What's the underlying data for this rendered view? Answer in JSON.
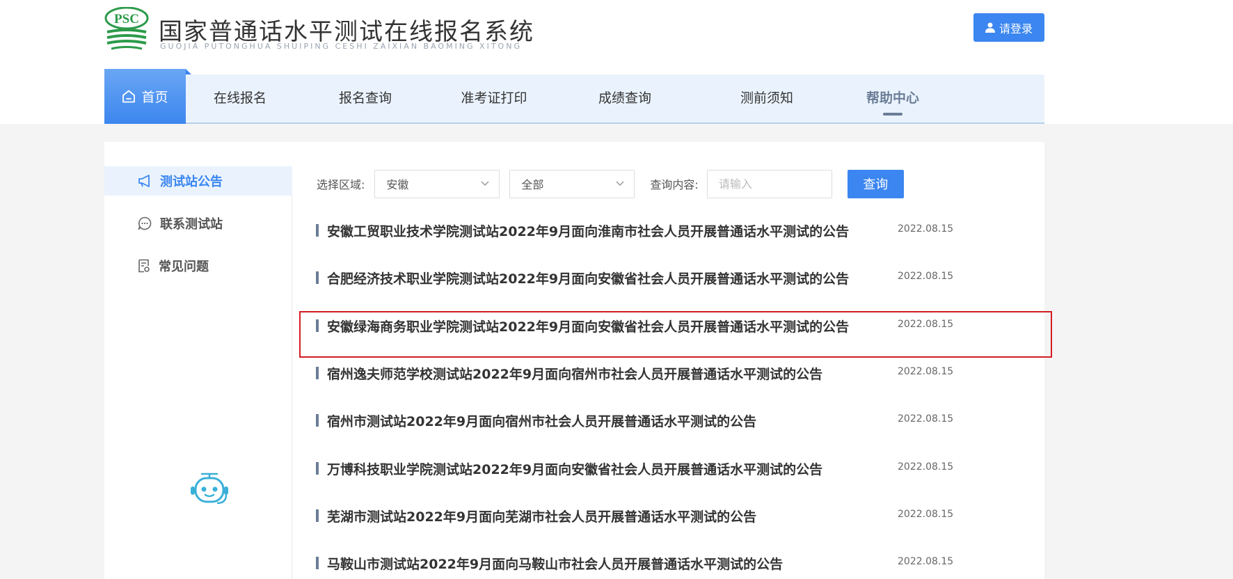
{
  "header": {
    "logo_badge": "PSC",
    "title": "国家普通话水平测试在线报名系统",
    "subtitle": "GUOJIA PUTONGHUA SHUIPING CESHI ZAIXIAN BAOMING XITONG",
    "login_label": "请登录"
  },
  "nav": {
    "home": "首页",
    "items": [
      {
        "label": "在线报名"
      },
      {
        "label": "报名查询"
      },
      {
        "label": "准考证打印"
      },
      {
        "label": "成绩查询"
      },
      {
        "label": "测前须知"
      },
      {
        "label": "帮助中心"
      }
    ],
    "active": "帮助中心"
  },
  "sidebar": {
    "items": [
      {
        "label": "测试站公告",
        "icon": "megaphone-icon"
      },
      {
        "label": "联系测试站",
        "icon": "chat-icon"
      },
      {
        "label": "常见问题",
        "icon": "document-icon"
      }
    ],
    "active": "测试站公告"
  },
  "filters": {
    "region_label": "选择区域:",
    "region_value": "安徽",
    "type_value": "全部",
    "query_label": "查询内容:",
    "query_placeholder": "请输入",
    "search_label": "查询"
  },
  "notices": [
    {
      "title": "安徽工贸职业技术学院测试站2022年9月面向淮南市社会人员开展普通话水平测试的公告",
      "date": "2022.08.15"
    },
    {
      "title": "合肥经济技术职业学院测试站2022年9月面向安徽省社会人员开展普通话水平测试的公告",
      "date": "2022.08.15"
    },
    {
      "title": "安徽绿海商务职业学院测试站2022年9月面向安徽省社会人员开展普通话水平测试的公告",
      "date": "2022.08.15"
    },
    {
      "title": "宿州逸夫师范学校测试站2022年9月面向宿州市社会人员开展普通话水平测试的公告",
      "date": "2022.08.15"
    },
    {
      "title": "宿州市测试站2022年9月面向宿州市社会人员开展普通话水平测试的公告",
      "date": "2022.08.15"
    },
    {
      "title": "万博科技职业学院测试站2022年9月面向安徽省社会人员开展普通话水平测试的公告",
      "date": "2022.08.15"
    },
    {
      "title": "芜湖市测试站2022年9月面向芜湖市社会人员开展普通话水平测试的公告",
      "date": "2022.08.15"
    },
    {
      "title": "马鞍山市测试站2022年9月面向马鞍山市社会人员开展普通话水平测试的公告",
      "date": "2022.08.15"
    }
  ],
  "colors": {
    "accent": "#3b86f0",
    "nav_bg": "#eaf3fd",
    "highlight_border": "#d21c22",
    "logo_green": "#2c9a4a"
  }
}
